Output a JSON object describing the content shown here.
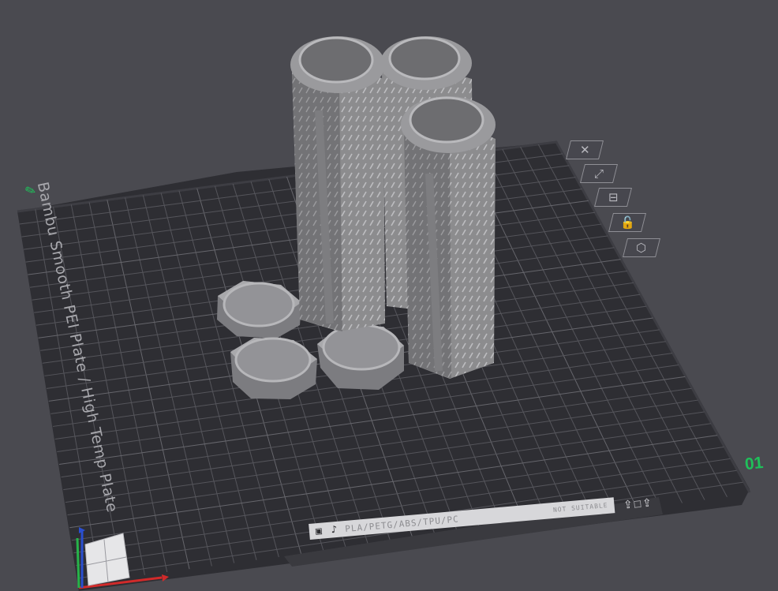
{
  "plate": {
    "label": "Bambu Smooth PEI Plate / High Temp Plate",
    "index": "01",
    "filament_types": "PLA/PETG/ABS/TPU/PC",
    "filament_icons": "▣ ♪",
    "not_suitable": "NOT SUITABLE",
    "corner_icons": "⇪□⇪"
  },
  "toolbar": {
    "close_icon": "✕",
    "arrange_icon": "⤢",
    "orient_icon": "⊟",
    "lock_icon": "🔓",
    "settings_icon": "⬡"
  },
  "edit_icon": "✎",
  "colors": {
    "background": "#4a4a50",
    "plate": "#2e2e33",
    "grid": "#55555b",
    "accent": "#1fc05a",
    "model": "#8e8e8e"
  }
}
